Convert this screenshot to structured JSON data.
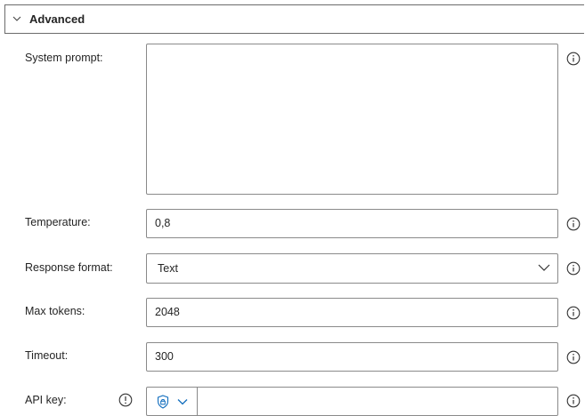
{
  "section": {
    "title": "Advanced",
    "chevron_icon": "chevron-down-icon"
  },
  "fields": {
    "system_prompt": {
      "label": "System prompt:",
      "value": ""
    },
    "temperature": {
      "label": "Temperature:",
      "value": "0,8"
    },
    "response_format": {
      "label": "Response format:",
      "value": "Text"
    },
    "max_tokens": {
      "label": "Max tokens:",
      "value": "2048"
    },
    "timeout": {
      "label": "Timeout:",
      "value": "300"
    },
    "api_key": {
      "label": "API key:",
      "value": "",
      "secure_icon": "shield-lock-icon"
    }
  },
  "icons": {
    "info": "info-icon",
    "dropdown": "chevron-down-icon"
  },
  "colors": {
    "accent": "#0f6cbd",
    "border": "#8a8a8a",
    "text": "#242424"
  }
}
